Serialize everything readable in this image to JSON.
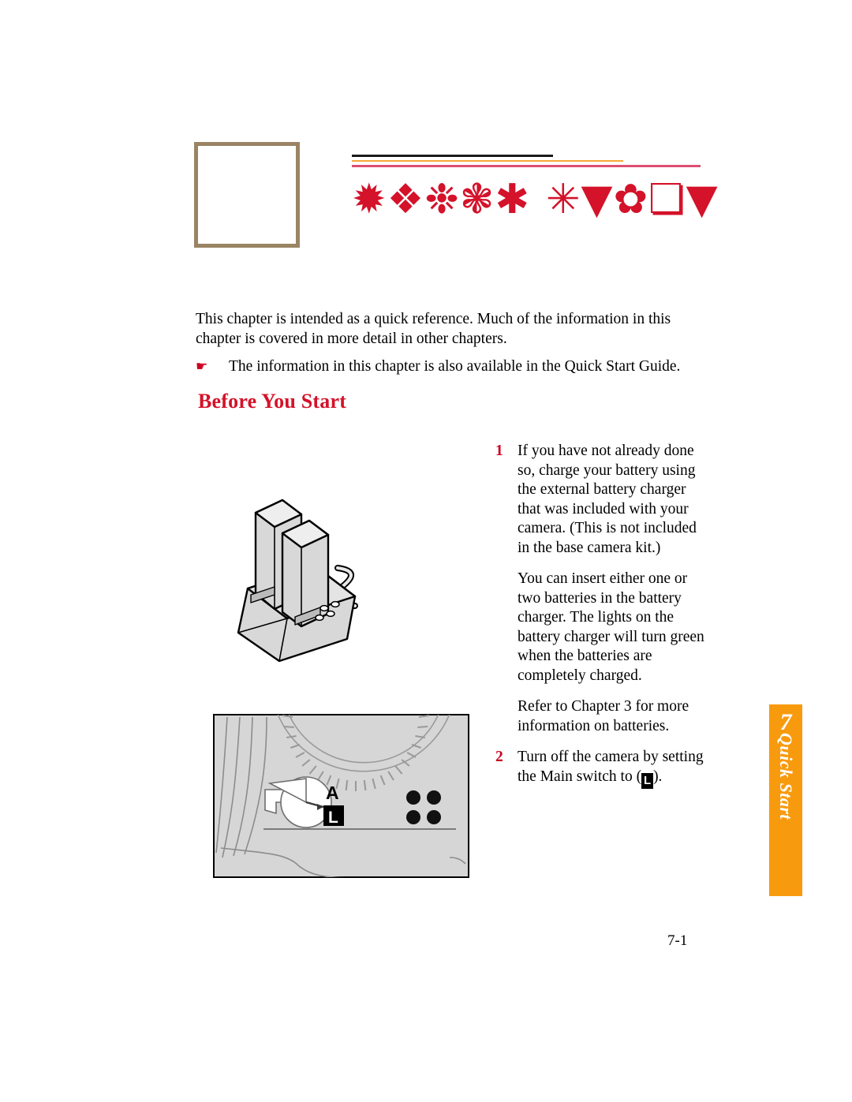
{
  "document": {
    "page_number": "7-1"
  },
  "header": {
    "chapter_title_text": "Quick Start",
    "chapter_title_dingbats_word1": "✹❖❉❃✱",
    "chapter_title_dingbats_word2": "✳▼✿❏▼",
    "rules": [
      {
        "name": "black-rule",
        "color": "#1a1a1a"
      },
      {
        "name": "orange-rule",
        "color": "#f7a838"
      },
      {
        "name": "red-rule",
        "color": "#dd4f72"
      }
    ],
    "chapter_box_color": "#9a8464"
  },
  "intro": {
    "paragraph": "This chapter is intended as a quick reference. Much of the information in this chapter is covered in more detail in other chapters.",
    "tip_icon": "pointing-hand-dingbat",
    "tip_icon_glyph": "☛",
    "tip_text": "The information in this chapter is also available in the Quick Start Guide."
  },
  "section": {
    "heading": "Before You Start",
    "heading_color": "#d4122a"
  },
  "steps": [
    {
      "number": "1",
      "paragraphs": [
        "If you have not already done so, charge your battery using the external battery charger that was included with your camera. (This is not included in the base camera kit.)",
        "You can insert either one or two batteries in the battery charger. The lights on the battery charger will turn green when the batteries are completely charged.",
        "Refer to Chapter 3 for more information on batteries."
      ]
    },
    {
      "number": "2",
      "text_before_glyph": "Turn off the camera by setting the Main switch to (",
      "glyph_label": "L",
      "text_after_glyph": ")."
    }
  ],
  "figures": {
    "charger": {
      "name": "external-battery-charger-illustration",
      "description": "Line drawing of an external battery charger with two batteries inserted and a power cable"
    },
    "camera_switch": {
      "name": "camera-main-switch-illustration",
      "description": "Line drawing of camera top plate showing Main switch positions",
      "labels": {
        "auto": "A",
        "lock": "L"
      }
    }
  },
  "side_tab": {
    "number": "7",
    "label": "Quick Start",
    "color": "#f89a0e"
  }
}
